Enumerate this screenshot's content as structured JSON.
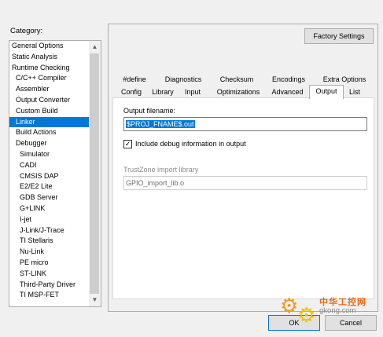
{
  "category": {
    "label": "Category:",
    "items": [
      {
        "label": "General Options",
        "level": 0,
        "selected": false
      },
      {
        "label": "Static Analysis",
        "level": 0,
        "selected": false
      },
      {
        "label": "Runtime Checking",
        "level": 0,
        "selected": false
      },
      {
        "label": "C/C++ Compiler",
        "level": 1,
        "selected": false
      },
      {
        "label": "Assembler",
        "level": 1,
        "selected": false
      },
      {
        "label": "Output Converter",
        "level": 1,
        "selected": false
      },
      {
        "label": "Custom Build",
        "level": 1,
        "selected": false
      },
      {
        "label": "Linker",
        "level": 1,
        "selected": true
      },
      {
        "label": "Build Actions",
        "level": 1,
        "selected": false
      },
      {
        "label": "Debugger",
        "level": 1,
        "selected": false
      },
      {
        "label": "Simulator",
        "level": 2,
        "selected": false
      },
      {
        "label": "CADI",
        "level": 2,
        "selected": false
      },
      {
        "label": "CMSIS DAP",
        "level": 2,
        "selected": false
      },
      {
        "label": "E2/E2 Lite",
        "level": 2,
        "selected": false
      },
      {
        "label": "GDB Server",
        "level": 2,
        "selected": false
      },
      {
        "label": "G+LINK",
        "level": 2,
        "selected": false
      },
      {
        "label": "I-jet",
        "level": 2,
        "selected": false
      },
      {
        "label": "J-Link/J-Trace",
        "level": 2,
        "selected": false
      },
      {
        "label": "TI Stellaris",
        "level": 2,
        "selected": false
      },
      {
        "label": "Nu-Link",
        "level": 2,
        "selected": false
      },
      {
        "label": "PE micro",
        "level": 2,
        "selected": false
      },
      {
        "label": "ST-LINK",
        "level": 2,
        "selected": false
      },
      {
        "label": "Third-Party Driver",
        "level": 2,
        "selected": false
      },
      {
        "label": "TI MSP-FET",
        "level": 2,
        "selected": false
      }
    ]
  },
  "factory_settings_label": "Factory Settings",
  "tabs_row1": [
    "#define",
    "Diagnostics",
    "Checksum",
    "Encodings",
    "Extra Options"
  ],
  "tabs_row2": [
    "Config",
    "Library",
    "Input",
    "Optimizations",
    "Advanced",
    "Output",
    "List"
  ],
  "active_tab": "Output",
  "output": {
    "filename_label": "Output filename:",
    "filename_value": "$PROJ_FNAME$.out",
    "include_debug_label": "Include debug information in output",
    "include_debug_checked": true,
    "trustzone_label": "TrustZone import library",
    "trustzone_value": "GPIO_import_lib.o"
  },
  "buttons": {
    "ok": "OK",
    "cancel": "Cancel"
  },
  "watermark": {
    "line1": "中华工控网",
    "line2": "gkong.com"
  },
  "colors": {
    "selection": "#0078d7",
    "panel_bg": "#f0f0f0",
    "watermark_orange": "#e46a1a"
  }
}
